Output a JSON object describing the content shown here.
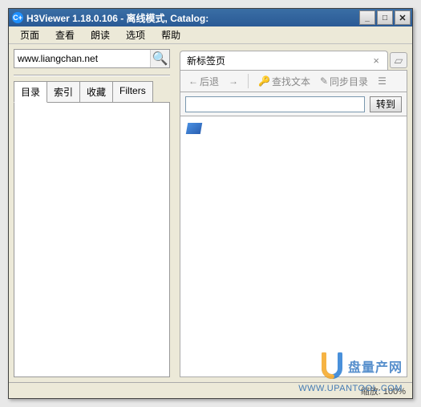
{
  "window": {
    "title": "H3Viewer 1.18.0.106 - 离线模式, Catalog:",
    "icon_label": "C+"
  },
  "menus": {
    "items": [
      "页面",
      "查看",
      "朗读",
      "选项",
      "帮助"
    ]
  },
  "left": {
    "search_value": "www.liangchan.net",
    "tabs": [
      "目录",
      "索引",
      "收藏",
      "Filters"
    ],
    "active_tab_index": 0
  },
  "right": {
    "tab_label": "新标签页",
    "toolbar": {
      "back": "后退",
      "find": "查找文本",
      "sync": "同步目录"
    },
    "address_value": "",
    "go_label": "转到"
  },
  "status": {
    "zoom": "缩放: 100%"
  },
  "watermark": {
    "brand": "盘量产网",
    "url": "WWW.UPANTOOL.COM"
  }
}
